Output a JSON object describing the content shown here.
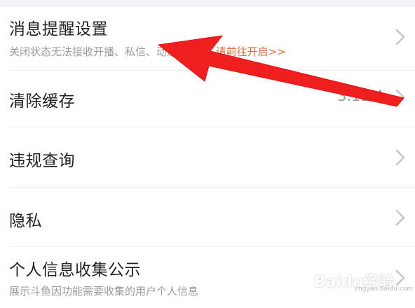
{
  "settings": {
    "items": [
      {
        "title": "消息提醒设置",
        "subtitle_text": "关闭状态无法接收开播、私信、",
        "subtitle_hidden": "动态等消息",
        "subtitle_link": "请前往开启>>"
      },
      {
        "title": "清除缓存",
        "value": "3.12M"
      },
      {
        "title": "违规查询"
      },
      {
        "title": "隐私"
      },
      {
        "title": "个人信息收集公示",
        "subtitle_text": "展示斗鱼因功能需要收集的用户个人信息"
      }
    ]
  },
  "watermark": {
    "brand": "Baidu经验",
    "site": "jingyan.baidu.com"
  },
  "colors": {
    "link": "#e86b3c",
    "annotation_arrow": "#f01f1f",
    "chevron": "#c7c7c7"
  }
}
